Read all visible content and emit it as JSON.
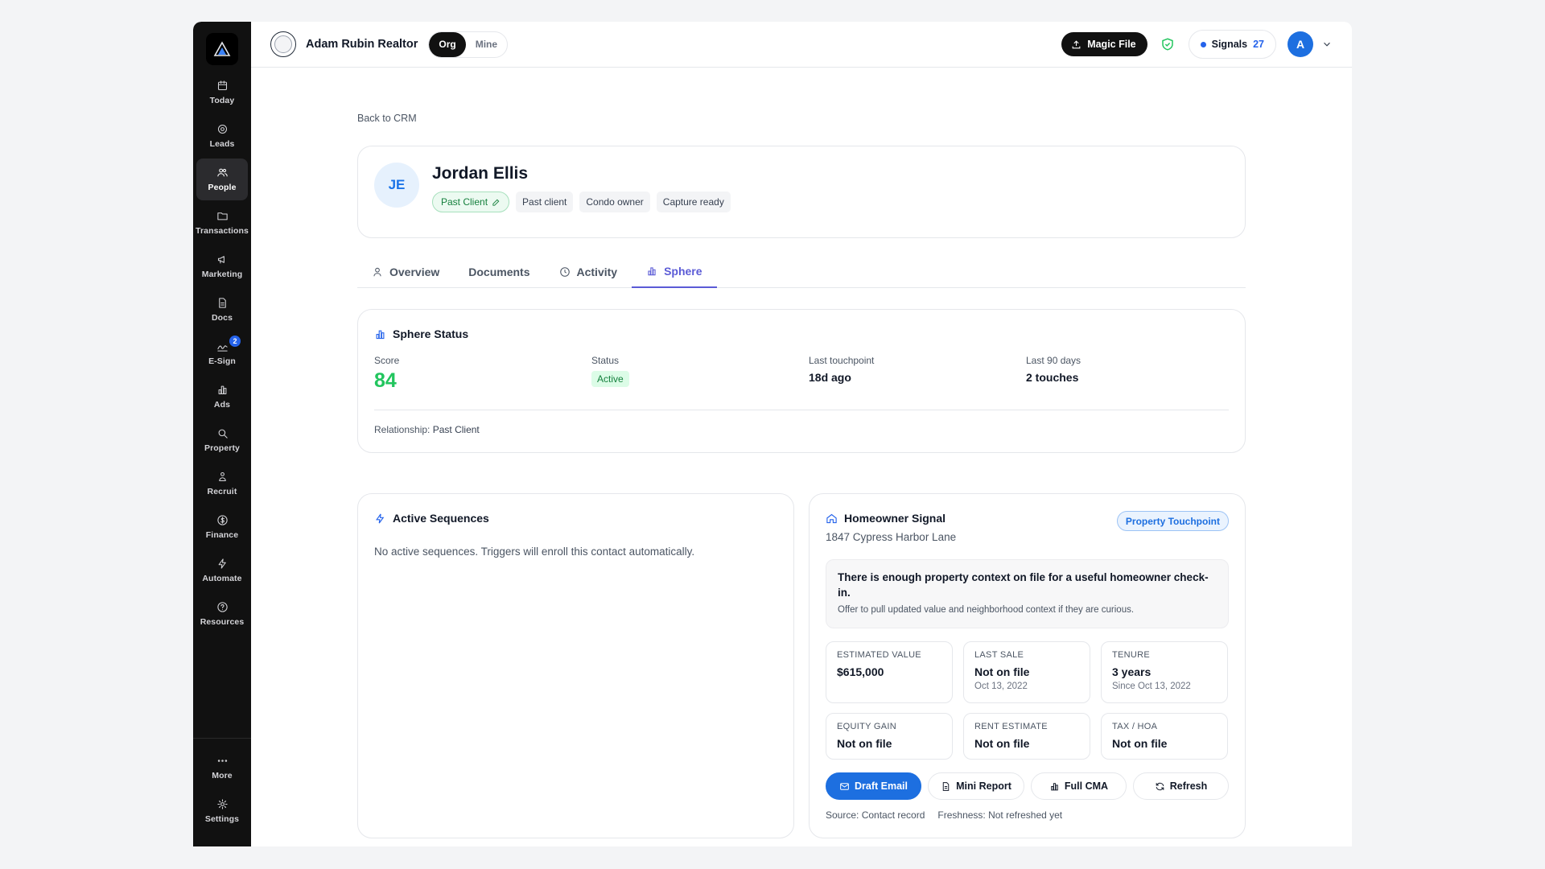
{
  "sidebar": {
    "items": [
      {
        "label": "Today",
        "icon": "calendar-icon"
      },
      {
        "label": "Leads",
        "icon": "target-icon"
      },
      {
        "label": "People",
        "icon": "people-icon",
        "active": true
      },
      {
        "label": "Transactions",
        "icon": "folder-icon"
      },
      {
        "label": "Marketing",
        "icon": "megaphone-icon"
      },
      {
        "label": "Docs",
        "icon": "document-icon"
      },
      {
        "label": "E-Sign",
        "icon": "signature-icon",
        "badge": "2"
      },
      {
        "label": "Ads",
        "icon": "bar-chart-icon"
      },
      {
        "label": "Property",
        "icon": "search-icon"
      },
      {
        "label": "Recruit",
        "icon": "users-icon"
      },
      {
        "label": "Finance",
        "icon": "dollar-icon"
      },
      {
        "label": "Automate",
        "icon": "lightning-icon"
      },
      {
        "label": "Resources",
        "icon": "help-icon"
      }
    ],
    "more_label": "More",
    "settings_label": "Settings"
  },
  "topbar": {
    "org_name": "Adam Rubin Realtor",
    "scope_org": "Org",
    "scope_mine": "Mine",
    "magic_file": "Magic File",
    "signals_label": "Signals",
    "signals_count": "27",
    "avatar_initial": "A"
  },
  "page": {
    "back_link": "Back to CRM",
    "contact": {
      "initials": "JE",
      "name": "Jordan Ellis",
      "stage_chip": "Past Client",
      "tags": [
        "Past client",
        "Condo owner",
        "Capture ready"
      ]
    },
    "tabs": [
      "Overview",
      "Documents",
      "Activity",
      "Sphere"
    ],
    "active_tab": "Sphere"
  },
  "sphere_status": {
    "title": "Sphere Status",
    "score_label": "Score",
    "score": "84",
    "status_label": "Status",
    "status": "Active",
    "last_touch_label": "Last touchpoint",
    "last_touch": "18d ago",
    "last90_label": "Last 90 days",
    "last90": "2 touches",
    "relationship_label": "Relationship:",
    "relationship": "Past Client"
  },
  "sequences": {
    "title": "Active Sequences",
    "empty": "No active sequences. Triggers will enroll this contact automatically."
  },
  "homeowner": {
    "title": "Homeowner Signal",
    "address": "1847 Cypress Harbor Lane",
    "badge": "Property Touchpoint",
    "insight_main": "There is enough property context on file for a useful homeowner check-in.",
    "insight_sub": "Offer to pull updated value and neighborhood context if they are curious.",
    "metrics": [
      {
        "label": "ESTIMATED VALUE",
        "value": "$615,000",
        "sub": ""
      },
      {
        "label": "LAST SALE",
        "value": "Not on file",
        "sub": "Oct 13, 2022"
      },
      {
        "label": "TENURE",
        "value": "3 years",
        "sub": "Since Oct 13, 2022"
      },
      {
        "label": "EQUITY GAIN",
        "value": "Not on file",
        "sub": ""
      },
      {
        "label": "RENT ESTIMATE",
        "value": "Not on file",
        "sub": ""
      },
      {
        "label": "TAX / HOA",
        "value": "Not on file",
        "sub": ""
      }
    ],
    "actions": [
      "Draft Email",
      "Mini Report",
      "Full CMA",
      "Refresh"
    ],
    "source": "Source: Contact record",
    "freshness": "Freshness: Not refreshed yet"
  },
  "colors": {
    "accent": "#5b5bd6",
    "primary_blue": "#1d6fe0",
    "score_green": "#22c55e",
    "sidebar_bg": "#111111"
  }
}
